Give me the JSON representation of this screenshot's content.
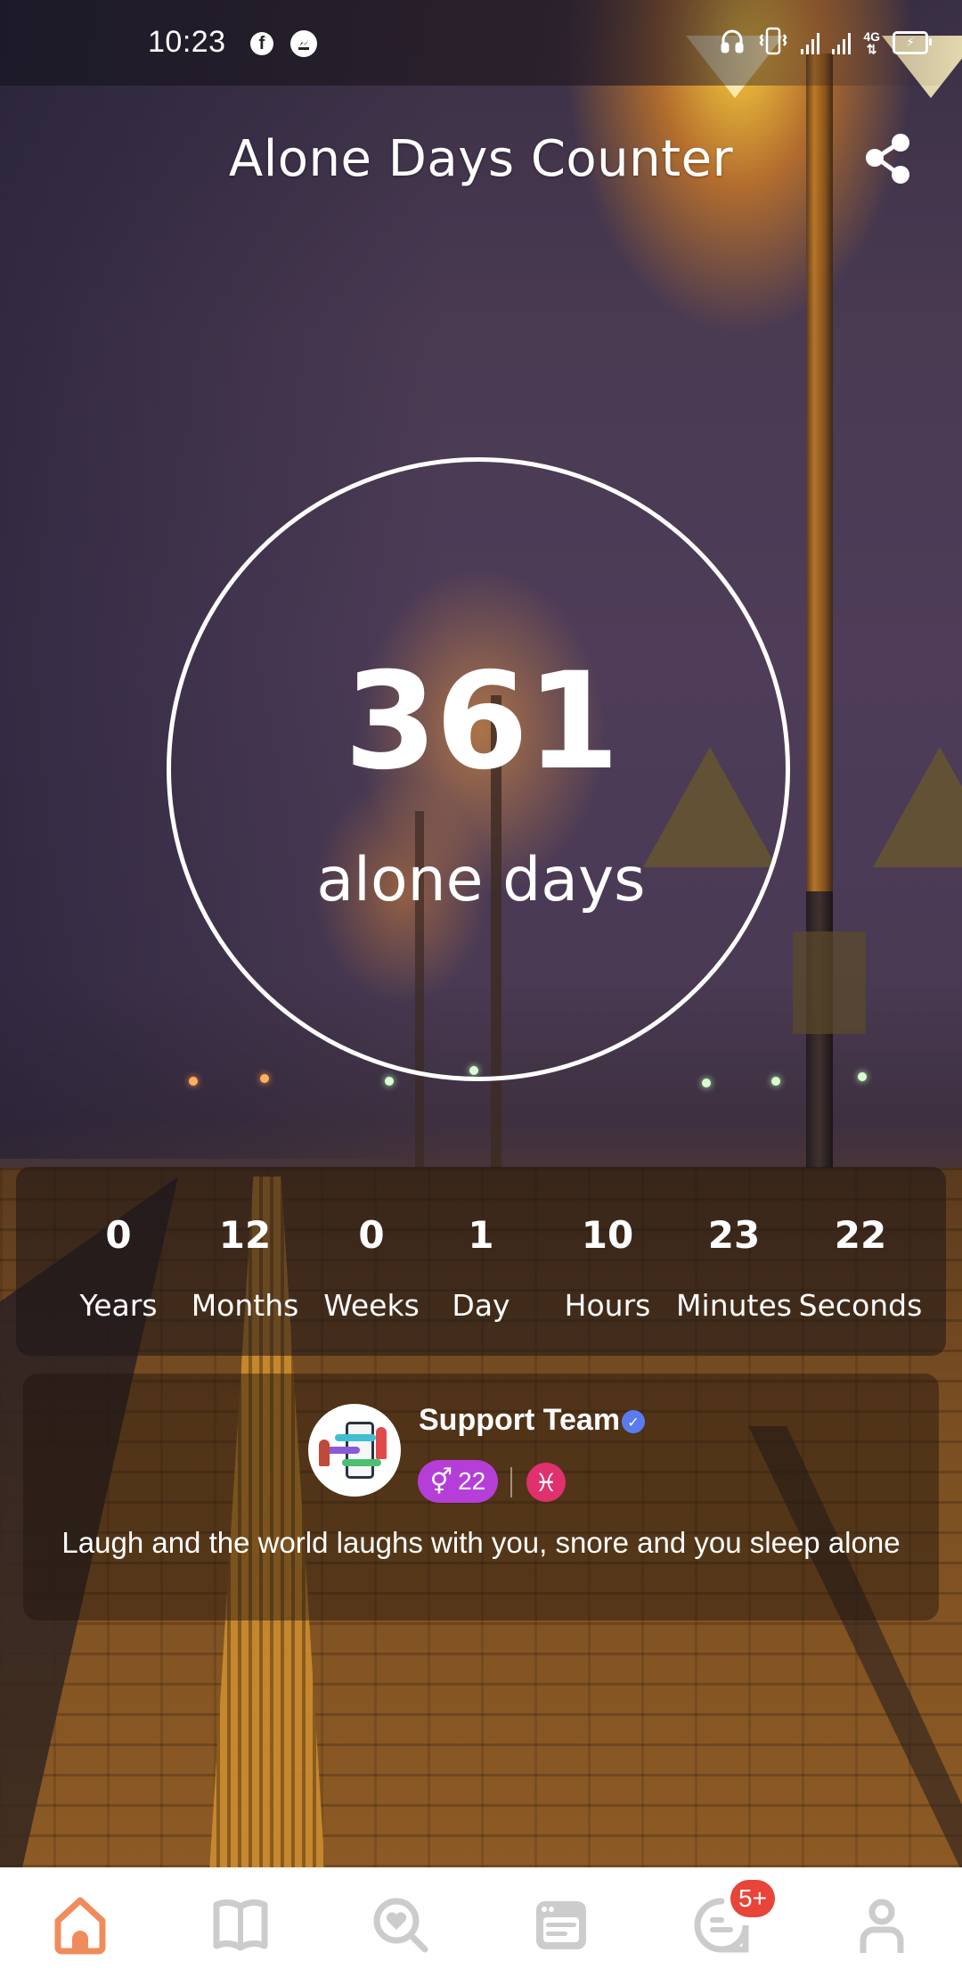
{
  "status_bar": {
    "time": "10:23",
    "left_icons": [
      "facebook-icon",
      "messenger-icon"
    ],
    "right_icons": [
      "headphones-icon",
      "vibrate-icon",
      "signal-icon",
      "signal-icon",
      "4g-icon",
      "battery-charging-icon"
    ],
    "network": "4G"
  },
  "header": {
    "title": "Alone Days Counter",
    "share_icon": "share-icon"
  },
  "counter": {
    "days": "361",
    "label": "alone days"
  },
  "breakdown": [
    {
      "value": "0",
      "unit": "Years"
    },
    {
      "value": "12",
      "unit": "Months"
    },
    {
      "value": "0",
      "unit": "Weeks"
    },
    {
      "value": "1",
      "unit": "Day"
    },
    {
      "value": "10",
      "unit": "Hours"
    },
    {
      "value": "23",
      "unit": "Minutes"
    },
    {
      "value": "22",
      "unit": "Seconds"
    }
  ],
  "quote_card": {
    "author": "Support Team",
    "verified": true,
    "age": "22",
    "gender_icon": "gender-icon",
    "zodiac_icon": "pisces-icon",
    "zodiac_symbol": "♓",
    "quote": "Laugh and the world laughs with you, snore and you sleep alone",
    "colors": {
      "age_pill": "#b63ed8",
      "zodiac": "#e0306e",
      "verified": "#5a7cf0"
    }
  },
  "bottom_nav": {
    "items": [
      {
        "name": "home",
        "icon": "home-icon",
        "active": true
      },
      {
        "name": "book",
        "icon": "book-icon",
        "active": false
      },
      {
        "name": "discover",
        "icon": "heart-search-icon",
        "active": false
      },
      {
        "name": "feed",
        "icon": "news-icon",
        "active": false
      },
      {
        "name": "messages",
        "icon": "chat-icon",
        "active": false,
        "badge": "5+"
      },
      {
        "name": "profile",
        "icon": "person-icon",
        "active": false
      }
    ],
    "colors": {
      "active": "#f08c5c",
      "inactive": "#cccccc",
      "badge": "#e8443a"
    }
  }
}
